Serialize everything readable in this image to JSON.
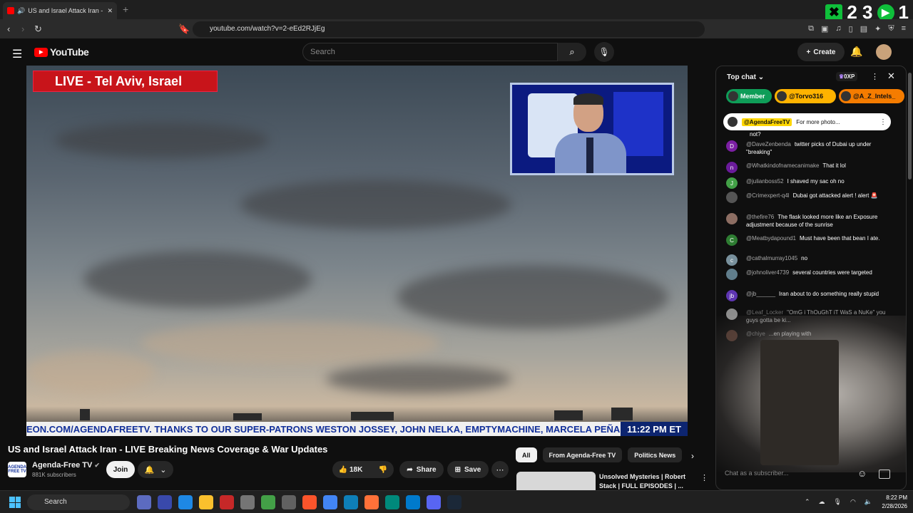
{
  "browser": {
    "tab_title": "US and Israel Attack Iran - LIVE",
    "url": "youtube.com/watch?v=2-eEd2RJjEg",
    "counter_left": "2 3",
    "counter_right": "1"
  },
  "header": {
    "logo": "YouTube",
    "search_placeholder": "Search",
    "create_label": "Create"
  },
  "video": {
    "live_banner": "LIVE - Tel Aviv, Israel",
    "ticker_text": "EON.COM/AGENDAFREETV. THANKS TO OUR SUPER-PATRONS WESTON JOSSEY, JOHN NELKA, EMPTYMACHINE, MARCELA PEÑA, I",
    "ticker_time": "11:22 PM ET",
    "title": "US and Israel Attack Iran - LIVE Breaking News Coverage & War Updates"
  },
  "channel": {
    "avatar_text": "AGENDA FREE TV",
    "name": "Agenda-Free TV",
    "subscribers": "881K subscribers",
    "join_label": "Join"
  },
  "actions": {
    "likes": "18K",
    "share": "Share",
    "save": "Save"
  },
  "recs": {
    "chips": [
      "All",
      "From Agenda-Free TV",
      "Politics News"
    ],
    "first_title": "Unsolved Mysteries | Robert Stack | FULL EPISODES | ..."
  },
  "chat": {
    "mode": "Top chat",
    "xp": "0XP",
    "tickers": [
      "Member",
      "@Torvo316",
      "@A_Z_Intels_"
    ],
    "pinned_author": "@AgendaFreeTV",
    "pinned_text": "For more photo...",
    "messages": [
      {
        "initial": "",
        "color": "#444444",
        "author": "",
        "text": "not?"
      },
      {
        "initial": "D",
        "color": "#7b1fa2",
        "author": "@DaveZenbenda",
        "text": "twitter picks of Dubai up under \"breaking\""
      },
      {
        "initial": "n",
        "color": "#6a1b9a",
        "author": "@Whatkindofnamecanimake",
        "text": "That it lol"
      },
      {
        "initial": "J",
        "color": "#43a047",
        "author": "@julianboss52",
        "text": "I shaved my sac oh no"
      },
      {
        "initial": "",
        "color": "#555555",
        "author": "@Crimexpert-q4l",
        "text": "Dubai got attacked alert ! alert 🚨"
      },
      {
        "initial": "",
        "color": "#8d6e63",
        "author": "@thefire76",
        "text": "The flask looked more like an Exposure adjustment because of the sunrise"
      },
      {
        "initial": "C",
        "color": "#2e7d32",
        "author": "@Meatbydapound1",
        "text": "Must have been that bean I ate."
      },
      {
        "initial": "c",
        "color": "#78909c",
        "author": "@cathalmurray1045",
        "text": "no"
      },
      {
        "initial": "",
        "color": "#607d8b",
        "author": "@johnoliver4739",
        "text": "several countries were targeted"
      },
      {
        "initial": "jb",
        "color": "#5e35b1",
        "author": "@jb______",
        "text": "Iran about to do something really stupid"
      },
      {
        "initial": "",
        "color": "#e0e0e0",
        "author": "@Leaf_Locker",
        "text": "\"OmG i ThOuGhT iT WaS a NuKe\" you guys gotta be ki..."
      },
      {
        "initial": "",
        "color": "#795548",
        "author": "@chiye",
        "text": "...en playing with"
      }
    ],
    "input_placeholder": "Chat as a subscriber..."
  },
  "taskbar": {
    "search_label": "Search",
    "time": "8:22 PM",
    "date": "2/28/2026"
  }
}
